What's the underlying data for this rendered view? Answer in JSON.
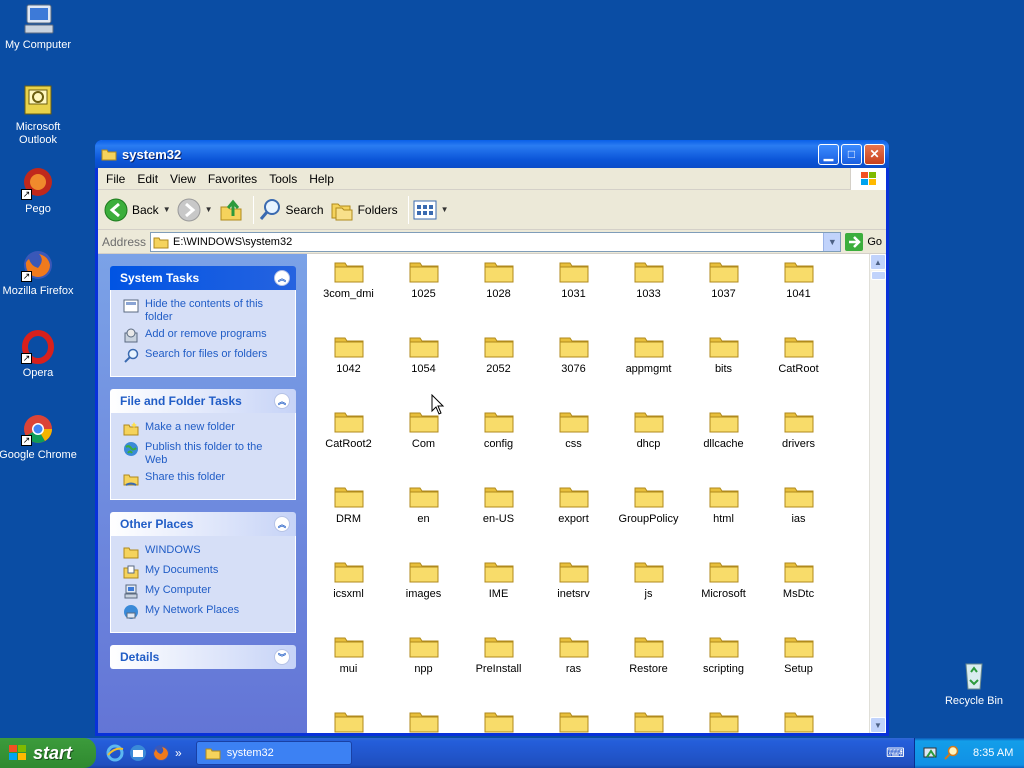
{
  "desktop": {
    "icons": [
      {
        "label": "My Computer",
        "icon": "my-computer-icon"
      },
      {
        "label": "Microsoft Outlook",
        "icon": "outlook-icon"
      },
      {
        "label": "Pego",
        "icon": "pego-icon"
      },
      {
        "label": "Mozilla Firefox",
        "icon": "firefox-icon"
      },
      {
        "label": "Opera",
        "icon": "opera-icon"
      },
      {
        "label": "Google Chrome",
        "icon": "chrome-icon"
      },
      {
        "label": "Recycle Bin",
        "icon": "recycle-bin-icon"
      }
    ]
  },
  "window": {
    "title": "system32",
    "menu": [
      "File",
      "Edit",
      "View",
      "Favorites",
      "Tools",
      "Help"
    ],
    "toolbar": {
      "back": "Back",
      "search": "Search",
      "folders": "Folders"
    },
    "address": {
      "label": "Address",
      "value": "E:\\WINDOWS\\system32",
      "go": "Go"
    }
  },
  "taskpane": {
    "system_tasks": {
      "title": "System Tasks",
      "items": [
        "Hide the contents of this folder",
        "Add or remove programs",
        "Search for files or folders"
      ]
    },
    "file_folder_tasks": {
      "title": "File and Folder Tasks",
      "items": [
        "Make a new folder",
        "Publish this folder to the Web",
        "Share this folder"
      ]
    },
    "other_places": {
      "title": "Other Places",
      "items": [
        "WINDOWS",
        "My Documents",
        "My Computer",
        "My Network Places"
      ]
    },
    "details": {
      "title": "Details"
    }
  },
  "folders": [
    "3com_dmi",
    "1025",
    "1028",
    "1031",
    "1033",
    "1037",
    "1041",
    "1042",
    "1054",
    "2052",
    "3076",
    "appmgmt",
    "bits",
    "CatRoot",
    "CatRoot2",
    "Com",
    "config",
    "css",
    "dhcp",
    "dllcache",
    "drivers",
    "DRM",
    "en",
    "en-US",
    "export",
    "GroupPolicy",
    "html",
    "ias",
    "icsxml",
    "images",
    "IME",
    "inetsrv",
    "js",
    "Microsoft",
    "MsDtc",
    "mui",
    "npp",
    "PreInstall",
    "ras",
    "Restore",
    "scripting",
    "Setup"
  ],
  "taskbar": {
    "start": "start",
    "task": "system32",
    "clock": "8:35 AM"
  },
  "colors": {
    "desktop": "#0a4da4",
    "titlebar": "#0a5fe8",
    "taskpane": "#7ba2e7",
    "folder": "#f5d35c"
  }
}
